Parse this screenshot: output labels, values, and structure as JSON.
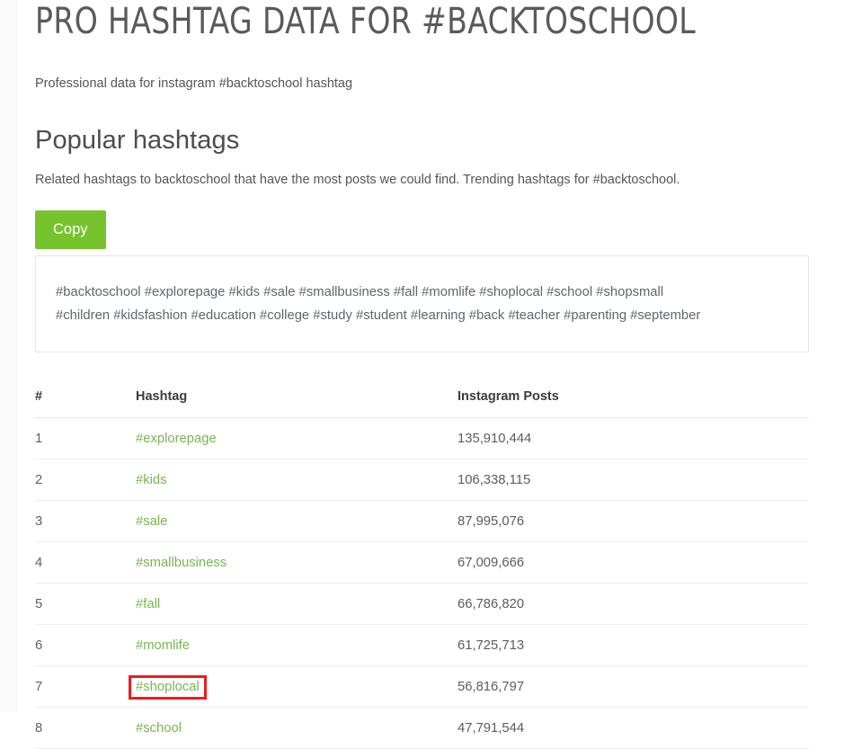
{
  "header": {
    "title": "PRO HASHTAG DATA FOR #BACKTOSCHOOL",
    "subtitle": "Professional data for instagram #backtoschool hashtag"
  },
  "section": {
    "title": "Popular hashtags",
    "description": "Related hashtags to backtoschool that have the most posts we could find. Trending hashtags for #backtoschool."
  },
  "copy_button": {
    "label": "Copy"
  },
  "hashtag_box": {
    "line1": "#backtoschool #explorepage #kids #sale #smallbusiness #fall #momlife #shoplocal #school #shopsmall",
    "line2": "#children #kidsfashion #education #college #study #student #learning #back #teacher #parenting #september"
  },
  "table": {
    "headers": {
      "rank": "#",
      "hashtag": "Hashtag",
      "posts": "Instagram Posts"
    },
    "rows": [
      {
        "rank": "1",
        "hashtag": "#explorepage",
        "posts": "135,910,444",
        "highlighted": false
      },
      {
        "rank": "2",
        "hashtag": "#kids",
        "posts": "106,338,115",
        "highlighted": false
      },
      {
        "rank": "3",
        "hashtag": "#sale",
        "posts": "87,995,076",
        "highlighted": false
      },
      {
        "rank": "4",
        "hashtag": "#smallbusiness",
        "posts": "67,009,666",
        "highlighted": false
      },
      {
        "rank": "5",
        "hashtag": "#fall",
        "posts": "66,786,820",
        "highlighted": false
      },
      {
        "rank": "6",
        "hashtag": "#momlife",
        "posts": "61,725,713",
        "highlighted": false
      },
      {
        "rank": "7",
        "hashtag": "#shoplocal",
        "posts": "56,816,797",
        "highlighted": true
      },
      {
        "rank": "8",
        "hashtag": "#school",
        "posts": "47,791,544",
        "highlighted": false
      }
    ]
  },
  "colors": {
    "accent_green": "#76c42d",
    "link_green": "#77b551",
    "highlight_red": "#ee1c1c",
    "text_gray": "#5c5c5c",
    "title_gray": "#5a5a5a"
  }
}
